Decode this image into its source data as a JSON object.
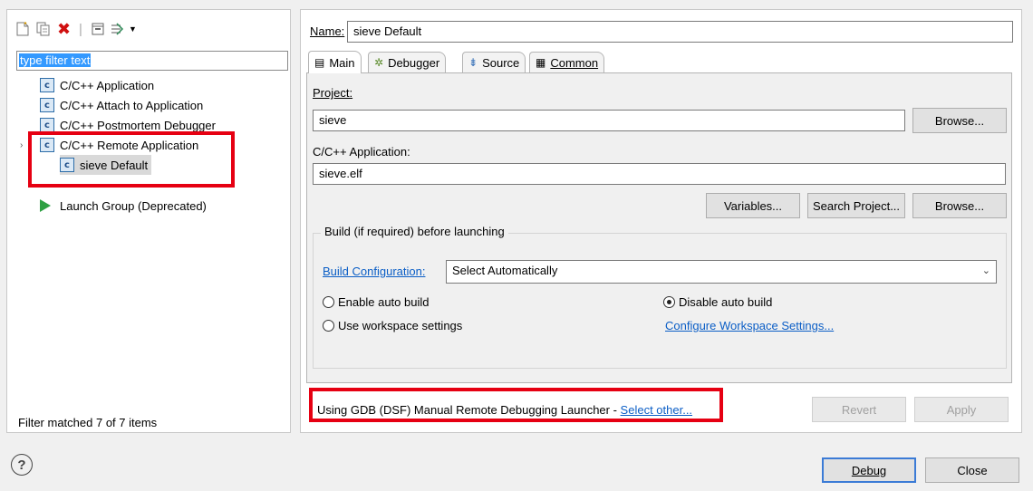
{
  "left": {
    "toolbar_icons": [
      "new-config-icon",
      "duplicate-icon",
      "delete-icon",
      "collapse-all-icon",
      "filter-icon",
      "dropdown-arrow-icon"
    ],
    "filter_placeholder": "type filter text",
    "tree": [
      {
        "label": "C/C++ Application",
        "icon": "c-config-icon"
      },
      {
        "label": "C/C++ Attach to Application",
        "icon": "c-config-icon"
      },
      {
        "label": "C/C++ Postmortem Debugger",
        "icon": "c-config-icon"
      },
      {
        "label": "C/C++ Remote Application",
        "icon": "c-config-icon",
        "expanded": true
      },
      {
        "label": "sieve Default",
        "icon": "c-config-icon",
        "selected": true
      },
      {
        "label": "Launch Group (Deprecated)",
        "icon": "launch-group-icon"
      }
    ],
    "filter_status": "Filter matched 7 of 7 items"
  },
  "right": {
    "name_label": "Name:",
    "name_value": "sieve Default",
    "tabs": [
      {
        "label": "Main",
        "icon": "main-tab-icon",
        "active": true
      },
      {
        "label": "Debugger",
        "icon": "debugger-bug-icon"
      },
      {
        "label": "Source",
        "icon": "source-icon"
      },
      {
        "label": "Common",
        "icon": "common-icon"
      }
    ],
    "project_label": "Project:",
    "project_value": "sieve",
    "browse_label": "Browse...",
    "app_label": "C/C++ Application:",
    "app_value": "sieve.elf",
    "variables_label": "Variables...",
    "search_project_label": "Search Project...",
    "build_group_title": "Build (if required) before launching",
    "build_config_link": "Build Configuration:",
    "build_config_value": "Select Automatically",
    "enable_auto_build": "Enable auto build",
    "disable_auto_build": "Disable auto build",
    "use_workspace": "Use workspace settings",
    "configure_workspace_link": "Configure Workspace Settings...",
    "launcher_text": "Using GDB (DSF) Manual Remote Debugging Launcher - ",
    "select_other_link": "Select other...",
    "revert_label": "Revert",
    "apply_label": "Apply"
  },
  "footer": {
    "help_icon": "help-icon",
    "debug_label": "Debug",
    "close_label": "Close"
  },
  "colors": {
    "highlight_box": "#e60012",
    "link": "#0b5ec6",
    "selection": "#3399ff"
  }
}
